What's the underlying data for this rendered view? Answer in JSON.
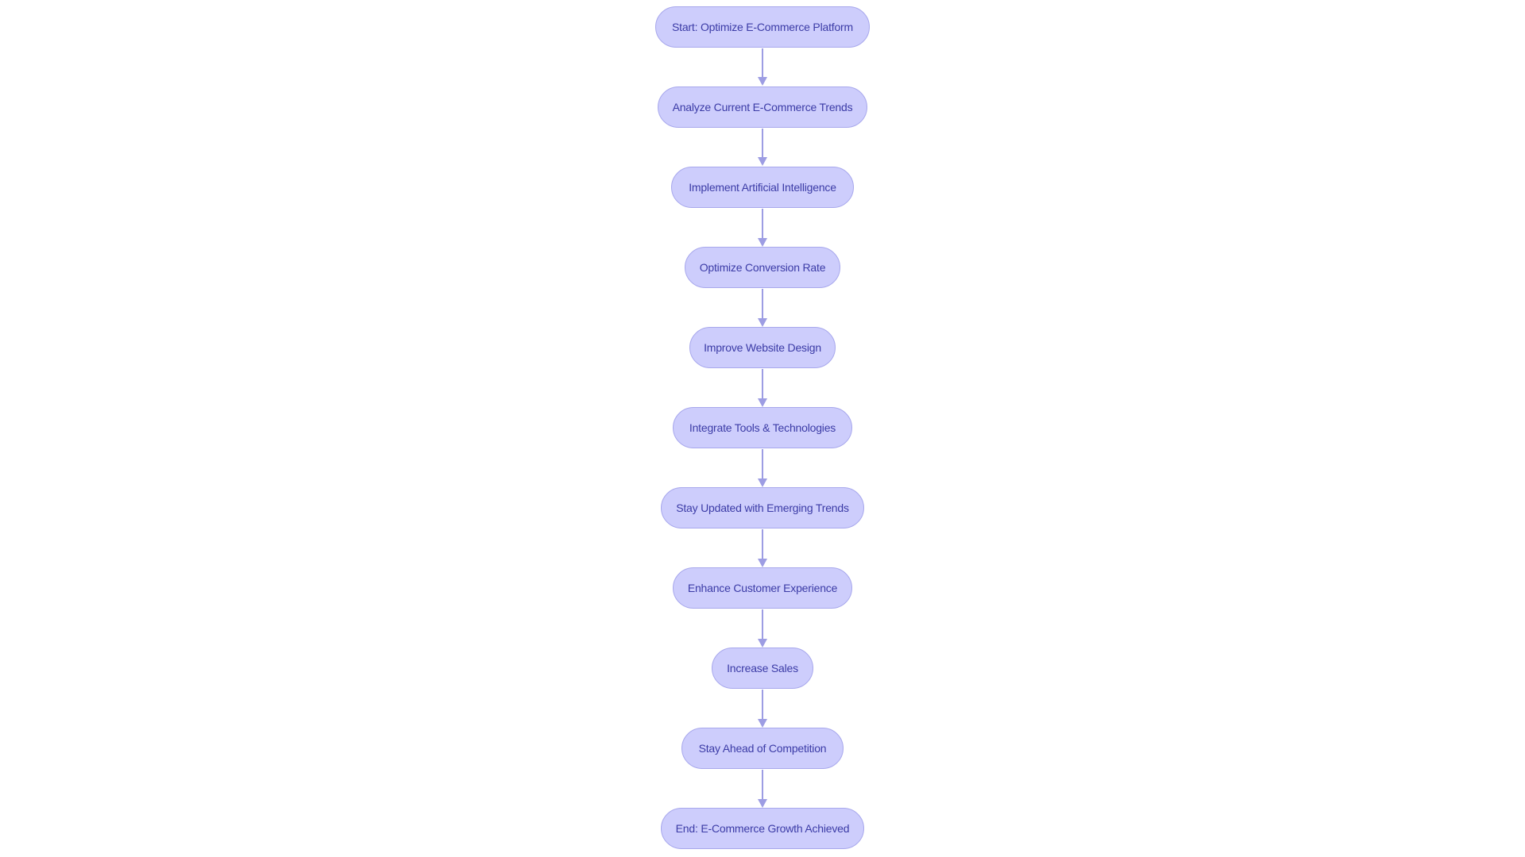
{
  "diagram": {
    "type": "flowchart",
    "direction": "top-to-bottom",
    "colors": {
      "node_fill": "#cdcdfc",
      "node_border": "#a7a7ec",
      "node_text": "#3b3ba6",
      "edge": "#9d9de3",
      "background": "#ffffff"
    },
    "nodes": [
      {
        "id": "n1",
        "label": "Start: Optimize E-Commerce Platform"
      },
      {
        "id": "n2",
        "label": "Analyze Current E-Commerce Trends"
      },
      {
        "id": "n3",
        "label": "Implement Artificial Intelligence"
      },
      {
        "id": "n4",
        "label": "Optimize Conversion Rate"
      },
      {
        "id": "n5",
        "label": "Improve Website Design"
      },
      {
        "id": "n6",
        "label": "Integrate Tools & Technologies"
      },
      {
        "id": "n7",
        "label": "Stay Updated with Emerging Trends"
      },
      {
        "id": "n8",
        "label": "Enhance Customer Experience"
      },
      {
        "id": "n9",
        "label": "Increase Sales"
      },
      {
        "id": "n10",
        "label": "Stay Ahead of Competition"
      },
      {
        "id": "n11",
        "label": "End: E-Commerce Growth Achieved"
      }
    ],
    "edges": [
      {
        "from": "n1",
        "to": "n2"
      },
      {
        "from": "n2",
        "to": "n3"
      },
      {
        "from": "n3",
        "to": "n4"
      },
      {
        "from": "n4",
        "to": "n5"
      },
      {
        "from": "n5",
        "to": "n6"
      },
      {
        "from": "n6",
        "to": "n7"
      },
      {
        "from": "n7",
        "to": "n8"
      },
      {
        "from": "n8",
        "to": "n9"
      },
      {
        "from": "n9",
        "to": "n10"
      },
      {
        "from": "n10",
        "to": "n11"
      }
    ]
  }
}
